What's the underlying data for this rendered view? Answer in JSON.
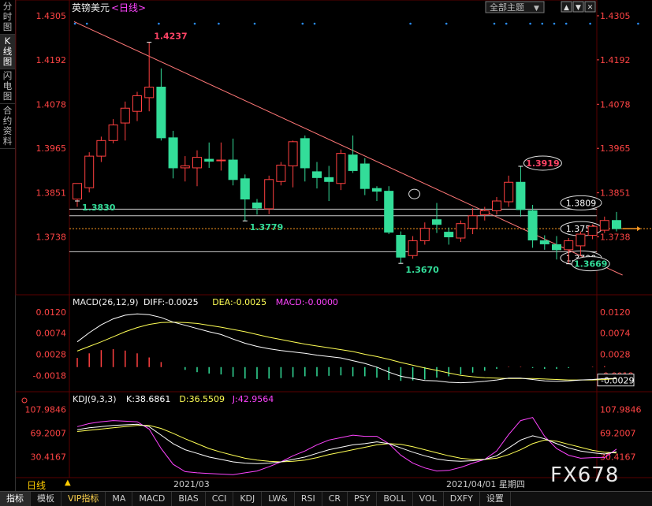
{
  "left_tabs": [
    {
      "label": "分\n时\n图",
      "active": false
    },
    {
      "label": "K\n线\n图",
      "active": true
    },
    {
      "label": "闪\n电\n图",
      "active": false
    },
    {
      "label": "合\n约\n资\n料",
      "active": false
    }
  ],
  "header": {
    "symbol": "英镑美元",
    "period_link": "<日线>",
    "theme_label": "全部主题",
    "theme_arrow": "▼",
    "btn_up": "▲",
    "btn_down": "▼",
    "btn_close": "✕"
  },
  "bottom_sub": {
    "period": "日线",
    "period_arrow": "▲",
    "month_label": "2021/03",
    "date_info": "2021/04/01 星期四"
  },
  "toolbar": [
    "指标",
    "模板",
    "VIP指标",
    "MA",
    "MACD",
    "BIAS",
    "CCI",
    "KDJ",
    "LW&",
    "RSI",
    "CR",
    "PSY",
    "BOLL",
    "VOL",
    "DXFY",
    "设置"
  ],
  "watermark": "FX678",
  "colors": {
    "up": "#ff4040",
    "down": "#33dd99",
    "yellow": "#ffff55",
    "magenta": "#ff44ff",
    "white": "#ffffff",
    "orange": "#ff9922"
  },
  "chart_data": [
    {
      "type": "candlestick",
      "ylim": [
        1.3638,
        1.4305
      ],
      "yticks": [
        "1.4305",
        "1.4192",
        "1.4078",
        "1.3965",
        "1.3851",
        "1.3738"
      ],
      "candles": [
        {
          "o": 1.3835,
          "h": 1.3864,
          "l": 1.3815,
          "c": 1.3875
        },
        {
          "o": 1.3864,
          "h": 1.3955,
          "l": 1.3852,
          "c": 1.3945
        },
        {
          "o": 1.3945,
          "h": 1.3995,
          "l": 1.393,
          "c": 1.3985
        },
        {
          "o": 1.3985,
          "h": 1.404,
          "l": 1.3978,
          "c": 1.4025
        },
        {
          "o": 1.403,
          "h": 1.4085,
          "l": 1.3985,
          "c": 1.4068
        },
        {
          "o": 1.406,
          "h": 1.411,
          "l": 1.4035,
          "c": 1.41
        },
        {
          "o": 1.4095,
          "h": 1.4237,
          "l": 1.406,
          "c": 1.4122
        },
        {
          "o": 1.4122,
          "h": 1.417,
          "l": 1.3985,
          "c": 1.3992
        },
        {
          "o": 1.3992,
          "h": 1.401,
          "l": 1.3888,
          "c": 1.3915
        },
        {
          "o": 1.3915,
          "h": 1.3945,
          "l": 1.388,
          "c": 1.392
        },
        {
          "o": 1.3915,
          "h": 1.396,
          "l": 1.3868,
          "c": 1.3942
        },
        {
          "o": 1.3937,
          "h": 1.398,
          "l": 1.3915,
          "c": 1.3932
        },
        {
          "o": 1.3935,
          "h": 1.398,
          "l": 1.3908,
          "c": 1.3935
        },
        {
          "o": 1.3935,
          "h": 1.399,
          "l": 1.387,
          "c": 1.3885
        },
        {
          "o": 1.3887,
          "h": 1.3898,
          "l": 1.3779,
          "c": 1.3835
        },
        {
          "o": 1.3825,
          "h": 1.3835,
          "l": 1.3795,
          "c": 1.3812
        },
        {
          "o": 1.381,
          "h": 1.3895,
          "l": 1.3796,
          "c": 1.3885
        },
        {
          "o": 1.388,
          "h": 1.393,
          "l": 1.387,
          "c": 1.3922
        },
        {
          "o": 1.392,
          "h": 1.3985,
          "l": 1.3865,
          "c": 1.3982
        },
        {
          "o": 1.399,
          "h": 1.3998,
          "l": 1.388,
          "c": 1.3915
        },
        {
          "o": 1.3905,
          "h": 1.393,
          "l": 1.3862,
          "c": 1.389
        },
        {
          "o": 1.389,
          "h": 1.392,
          "l": 1.383,
          "c": 1.388
        },
        {
          "o": 1.3875,
          "h": 1.3962,
          "l": 1.3858,
          "c": 1.3952
        },
        {
          "o": 1.3948,
          "h": 1.3998,
          "l": 1.3902,
          "c": 1.3908
        },
        {
          "o": 1.3925,
          "h": 1.394,
          "l": 1.3845,
          "c": 1.3862
        },
        {
          "o": 1.3862,
          "h": 1.3868,
          "l": 1.383,
          "c": 1.3855
        },
        {
          "o": 1.3855,
          "h": 1.3868,
          "l": 1.3745,
          "c": 1.375
        },
        {
          "o": 1.3742,
          "h": 1.3752,
          "l": 1.367,
          "c": 1.3686
        },
        {
          "o": 1.369,
          "h": 1.374,
          "l": 1.3682,
          "c": 1.3728
        },
        {
          "o": 1.3728,
          "h": 1.3775,
          "l": 1.3718,
          "c": 1.376
        },
        {
          "o": 1.3782,
          "h": 1.3825,
          "l": 1.3748,
          "c": 1.377
        },
        {
          "o": 1.375,
          "h": 1.3762,
          "l": 1.3718,
          "c": 1.3738
        },
        {
          "o": 1.3735,
          "h": 1.378,
          "l": 1.3725,
          "c": 1.3772
        },
        {
          "o": 1.376,
          "h": 1.3812,
          "l": 1.3745,
          "c": 1.3792
        },
        {
          "o": 1.3795,
          "h": 1.3815,
          "l": 1.378,
          "c": 1.3805
        },
        {
          "o": 1.3805,
          "h": 1.384,
          "l": 1.3795,
          "c": 1.383
        },
        {
          "o": 1.3828,
          "h": 1.3895,
          "l": 1.3815,
          "c": 1.3878
        },
        {
          "o": 1.3878,
          "h": 1.3919,
          "l": 1.379,
          "c": 1.3808
        },
        {
          "o": 1.3805,
          "h": 1.382,
          "l": 1.371,
          "c": 1.373
        },
        {
          "o": 1.3728,
          "h": 1.3742,
          "l": 1.3705,
          "c": 1.372
        },
        {
          "o": 1.3718,
          "h": 1.374,
          "l": 1.368,
          "c": 1.3705
        },
        {
          "o": 1.3705,
          "h": 1.3735,
          "l": 1.3669,
          "c": 1.3728
        },
        {
          "o": 1.3715,
          "h": 1.3752,
          "l": 1.369,
          "c": 1.3745
        },
        {
          "o": 1.3742,
          "h": 1.377,
          "l": 1.3732,
          "c": 1.3765
        },
        {
          "o": 1.3755,
          "h": 1.379,
          "l": 1.3748,
          "c": 1.378
        },
        {
          "o": 1.378,
          "h": 1.3802,
          "l": 1.3752,
          "c": 1.3759
        }
      ],
      "annotations": [
        {
          "text": "1.4237",
          "value": 1.4237,
          "index": 6,
          "color": "#ff4466"
        },
        {
          "text": "1.3830",
          "value": 1.383,
          "index": 0,
          "color": "#33dd99"
        },
        {
          "text": "1.3779",
          "value": 1.3779,
          "index": 14,
          "color": "#33dd99"
        },
        {
          "text": "1.3670",
          "value": 1.367,
          "index": 27,
          "color": "#33dd99"
        },
        {
          "text": "1.3919",
          "value": 1.3919,
          "index": 37,
          "color": "#ff4466",
          "boxed": true
        },
        {
          "text": "1.3669",
          "value": 1.3669,
          "index": 41,
          "color": "#33dd99",
          "boxed": true
        }
      ],
      "hlines": [
        {
          "value": 1.3809,
          "label": "1.3809"
        },
        {
          "value": 1.3759,
          "label": "1.3759",
          "dashed": true
        },
        {
          "value": 1.37,
          "label": "1.3700"
        }
      ],
      "extra_hlines": [
        1.3792
      ],
      "trendline": {
        "from": [
          0,
          1.429
        ],
        "to": [
          45.5,
          1.364
        ]
      },
      "dots_value": 1.4285
    },
    {
      "type": "macd",
      "title": "MACD(26,12,9)",
      "labels": [
        {
          "text": "DIFF:-0.0025",
          "color": "#ffffff"
        },
        {
          "text": "DEA:-0.0025",
          "color": "#ffff55"
        },
        {
          "text": "MACD:-0.0000",
          "color": "#ff44ff"
        }
      ],
      "ylim": [
        -0.0045,
        0.013
      ],
      "yticks": [
        "0.0120",
        "0.0074",
        "0.0028",
        "-0.0018"
      ],
      "current_label": "-0.0029",
      "diff": [
        0.0055,
        0.0075,
        0.0092,
        0.0105,
        0.0113,
        0.0116,
        0.0114,
        0.0108,
        0.0098,
        0.0091,
        0.0084,
        0.0077,
        0.0071,
        0.0061,
        0.0052,
        0.0045,
        0.004,
        0.0036,
        0.0033,
        0.003,
        0.0026,
        0.0023,
        0.002,
        0.0014,
        0.0008,
        0.0,
        -0.0011,
        -0.002,
        -0.0025,
        -0.0029,
        -0.003,
        -0.0033,
        -0.0034,
        -0.0033,
        -0.0031,
        -0.0028,
        -0.0024,
        -0.0024,
        -0.0027,
        -0.003,
        -0.0031,
        -0.003,
        -0.0028,
        -0.0027,
        -0.0025,
        -0.0025
      ],
      "dea": [
        0.0035,
        0.0045,
        0.0055,
        0.0066,
        0.0077,
        0.0086,
        0.0093,
        0.0097,
        0.0098,
        0.0097,
        0.0095,
        0.0091,
        0.0087,
        0.0082,
        0.0077,
        0.0071,
        0.0065,
        0.006,
        0.0055,
        0.005,
        0.0046,
        0.0042,
        0.0038,
        0.0034,
        0.0028,
        0.0023,
        0.0017,
        0.001,
        0.0004,
        -0.0002,
        -0.0007,
        -0.0013,
        -0.0018,
        -0.0021,
        -0.0023,
        -0.0024,
        -0.0025,
        -0.0025,
        -0.0025,
        -0.0026,
        -0.0027,
        -0.0028,
        -0.0028,
        -0.0028,
        -0.0027,
        -0.0025
      ],
      "macd": [
        0.002,
        0.003,
        0.0037,
        0.0039,
        0.0036,
        0.003,
        0.0021,
        0.0011,
        0.0,
        -0.0006,
        -0.0011,
        -0.0014,
        -0.0016,
        -0.0021,
        -0.0025,
        -0.0026,
        -0.0025,
        -0.0024,
        -0.0022,
        -0.002,
        -0.002,
        -0.0019,
        -0.0018,
        -0.002,
        -0.002,
        -0.0023,
        -0.0028,
        -0.003,
        -0.0029,
        -0.0027,
        -0.0023,
        -0.002,
        -0.0016,
        -0.0012,
        -0.0008,
        -0.0004,
        0.0001,
        0.0001,
        -0.0002,
        -0.0004,
        -0.0004,
        -0.0002,
        0.0,
        0.0001,
        0.0002,
        -0.0
      ]
    },
    {
      "type": "kdj",
      "title": "KDJ(9,3,3)",
      "labels": [
        {
          "text": "K:38.6861",
          "color": "#ffffff"
        },
        {
          "text": "D:36.5509",
          "color": "#ffff55"
        },
        {
          "text": "J:42.9564",
          "color": "#ff44ff"
        }
      ],
      "ylim": [
        0,
        118
      ],
      "yticks": [
        "107.9846",
        "69.2007",
        "30.4167"
      ],
      "k": [
        75,
        78,
        80,
        82,
        83,
        84,
        80,
        66,
        52,
        42,
        36,
        30,
        26,
        22,
        20,
        19,
        20,
        22,
        26,
        30,
        36,
        42,
        46,
        50,
        52,
        55,
        52,
        45,
        38,
        32,
        27,
        24,
        23,
        24,
        26,
        32,
        45,
        58,
        65,
        60,
        52,
        45,
        40,
        37,
        35,
        38.7
      ],
      "d": [
        72,
        74,
        76,
        78,
        80,
        82,
        82,
        77,
        69,
        60,
        52,
        44,
        38,
        33,
        28,
        25,
        23,
        22,
        23,
        25,
        29,
        34,
        38,
        42,
        46,
        50,
        52,
        51,
        47,
        42,
        37,
        32,
        28,
        26,
        26,
        28,
        34,
        42,
        52,
        58,
        56,
        51,
        46,
        41,
        38,
        36.6
      ],
      "j": [
        80,
        85,
        88,
        90,
        89,
        88,
        76,
        44,
        18,
        6,
        4,
        3,
        2,
        1,
        4,
        7,
        14,
        22,
        32,
        40,
        50,
        58,
        62,
        66,
        64,
        64,
        52,
        33,
        20,
        12,
        7,
        8,
        13,
        20,
        26,
        40,
        67,
        90,
        95,
        64,
        44,
        33,
        28,
        29,
        29,
        43
      ]
    }
  ]
}
